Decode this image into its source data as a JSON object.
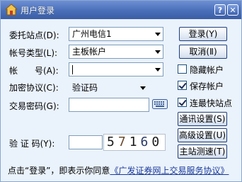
{
  "window": {
    "title": "用户登录",
    "help_label": "?",
    "close_label": "✕"
  },
  "form": {
    "site_label": "委托站点(D):",
    "site_value": "广州电信1",
    "account_type_label": "帐号类型(L):",
    "account_type_value": "主板帐户",
    "account_label": "帐　　号(A):",
    "account_value": "",
    "encryption_label": "加密协议(C):",
    "encryption_value": "验证码",
    "password_label": "交易密码(G):",
    "password_value": "",
    "captcha_label": "验 证 码(Y):",
    "captcha_input": "",
    "captcha_digits": [
      "5",
      "7",
      "1",
      "6",
      "0"
    ]
  },
  "buttons": {
    "login": "登录(Y)",
    "cancel": "取消(Ⅱ)",
    "comm_settings": "通讯设置(S)",
    "advanced_settings": "高级设置(U)",
    "site_speed_test": "主站测速(T)"
  },
  "checkboxes": {
    "hide_account": {
      "label": "隐藏帐户",
      "checked": false
    },
    "save_account": {
      "label": "保存帐户",
      "checked": true
    },
    "fastest_site": {
      "label": "连最快站点",
      "checked": true
    }
  },
  "footer": {
    "prefix": "点击“登录”，即表示你同意",
    "link": "《广发证券网上交易服务协议》"
  },
  "icons": {
    "app": "house-icon",
    "keyboard": "keyboard-icon",
    "combo": "chevron-down-icon"
  },
  "colors": {
    "titlebar": "#4a6fb9",
    "window_bg": "#eaf2fb",
    "link": "#1a3a9c"
  }
}
